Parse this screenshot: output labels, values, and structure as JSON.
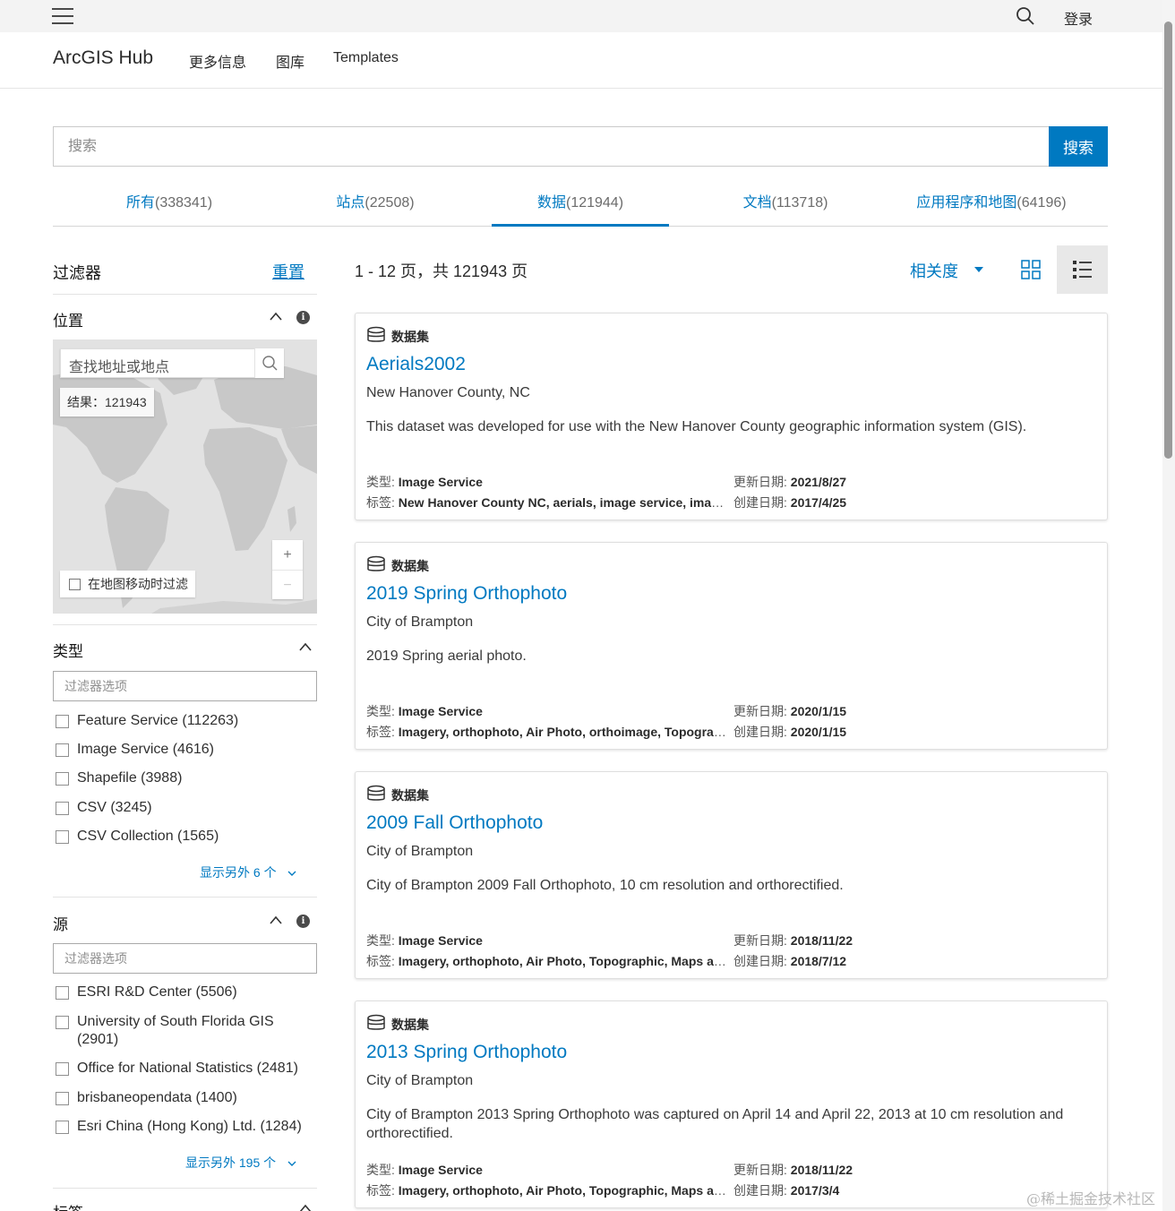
{
  "topbar": {
    "login_label": "登录"
  },
  "header": {
    "brand": "ArcGIS Hub",
    "nav": [
      "更多信息",
      "图库",
      "Templates"
    ]
  },
  "search": {
    "placeholder": "搜索",
    "button_label": "搜索"
  },
  "tabs": [
    {
      "label": "所有",
      "count": "(338341)"
    },
    {
      "label": "站点",
      "count": "(22508)"
    },
    {
      "label": "数据",
      "count": "(121944)",
      "active": true
    },
    {
      "label": "文档",
      "count": "(113718)"
    },
    {
      "label": "应用程序和地图",
      "count": "(64196)"
    }
  ],
  "filters": {
    "title": "过滤器",
    "reset_label": "重置",
    "location": {
      "title": "位置",
      "map_search_placeholder": "查找地址或地点",
      "results_label": "结果：121943",
      "zoom_in": "+",
      "zoom_out": "−",
      "map_filter_label": "在地图移动时过滤"
    },
    "type": {
      "title": "类型",
      "placeholder": "过滤器选项",
      "options": [
        "Feature Service (112263)",
        "Image Service (4616)",
        "Shapefile (3988)",
        "CSV (3245)",
        "CSV Collection (1565)"
      ],
      "more_label": "显示另外 6 个"
    },
    "source": {
      "title": "源",
      "placeholder": "过滤器选项",
      "options": [
        "ESRI R&D Center (5506)",
        "University of South Florida GIS",
        "(2901)",
        "Office for National Statistics (2481)",
        "brisbaneopendata (1400)",
        "Esri China (Hong Kong) Ltd. (1284)"
      ],
      "more_label": "显示另外 195 个"
    },
    "tags": {
      "title": "标签"
    }
  },
  "results": {
    "summary": "1 - 12 页，共 121943 页",
    "sort_label": "相关度",
    "items": [
      {
        "type": "数据集",
        "title": "Aerials2002",
        "owner": "New Hanover County, NC",
        "description": "This dataset was developed for use with the New Hanover County geographic information system (GIS).",
        "type_key": "类型:",
        "type_value": "Image Service",
        "tags_key": "标签:",
        "tags_value": "New Hanover County NC, aerials, image service, imagery",
        "updated_key": "更新日期:",
        "updated_value": "2021/8/27",
        "created_key": "创建日期:",
        "created_value": "2017/4/25"
      },
      {
        "type": "数据集",
        "title": "2019 Spring Orthophoto",
        "owner": "City of Brampton",
        "description": "2019 Spring aerial photo.",
        "type_key": "类型:",
        "type_value": "Image Service",
        "tags_key": "标签:",
        "tags_value": "Imagery, orthophoto, Air Photo, orthoimage, Topographic",
        "updated_key": "更新日期:",
        "updated_value": "2020/1/15",
        "created_key": "创建日期:",
        "created_value": "2020/1/15"
      },
      {
        "type": "数据集",
        "title": "2009 Fall Orthophoto",
        "owner": "City of Brampton",
        "description": "City of Brampton 2009 Fall Orthophoto, 10 cm resolution and orthorectified.",
        "type_key": "类型:",
        "type_value": "Image Service",
        "tags_key": "标签:",
        "tags_value": "Imagery, orthophoto, Air Photo, Topographic, Maps and Atlases",
        "updated_key": "更新日期:",
        "updated_value": "2018/11/22",
        "created_key": "创建日期:",
        "created_value": "2018/7/12"
      },
      {
        "type": "数据集",
        "title": "2013 Spring Orthophoto",
        "owner": "City of Brampton",
        "description": "City of Brampton 2013 Spring Orthophoto was captured on April 14 and April 22, 2013 at 10 cm resolution and orthorectified.",
        "type_key": "类型:",
        "type_value": "Image Service",
        "tags_key": "标签:",
        "tags_value": "Imagery, orthophoto, Air Photo, Topographic, Maps and Atlases",
        "updated_key": "更新日期:",
        "updated_value": "2018/11/22",
        "created_key": "创建日期:",
        "created_value": "2017/3/4"
      }
    ]
  },
  "watermark": "@稀土掘金技术社区",
  "colors": {
    "accent": "#0079c1",
    "text": "#151515",
    "map_land": "#c8c8c8",
    "map_water": "#e2e2e2"
  }
}
